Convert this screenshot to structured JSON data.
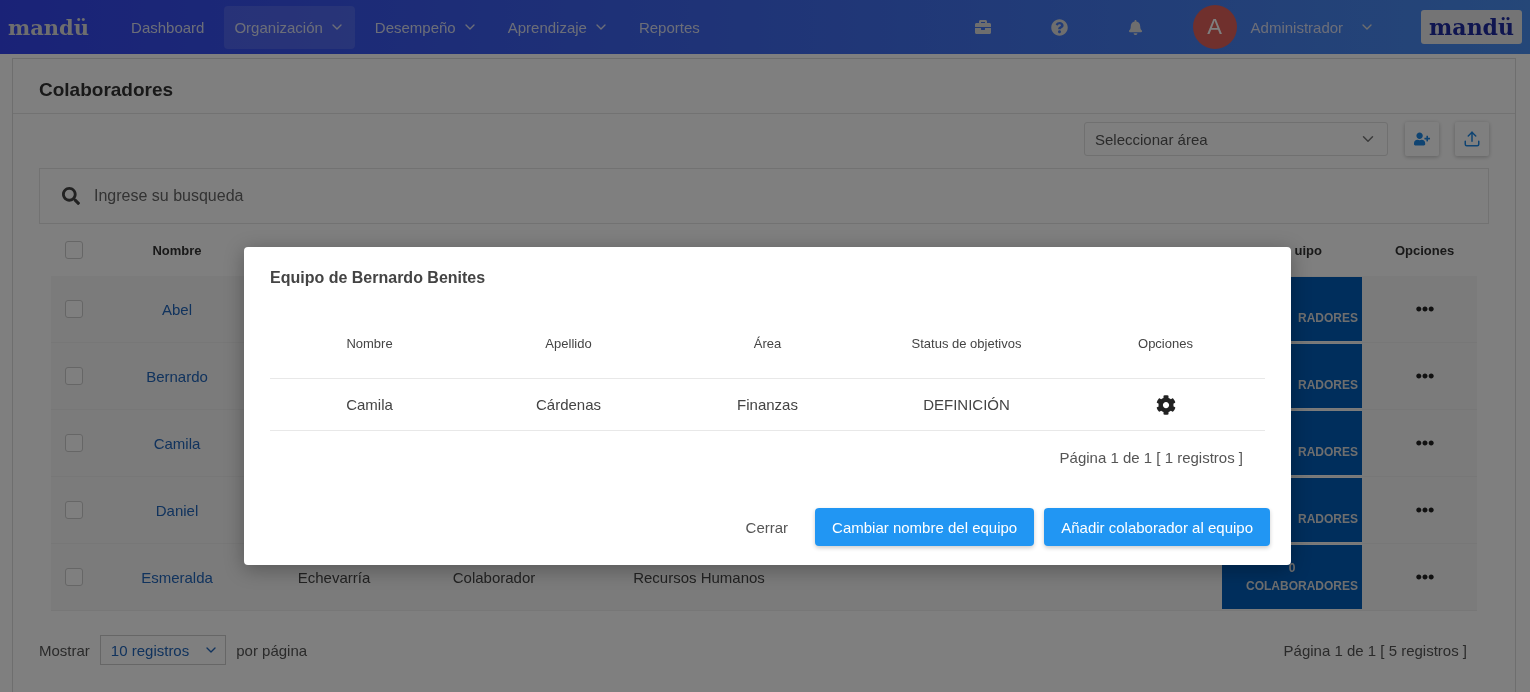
{
  "nav": {
    "logo": "mandü",
    "items": [
      {
        "label": "Dashboard",
        "dropdown": false,
        "selected": false
      },
      {
        "label": "Organización",
        "dropdown": true,
        "selected": true
      },
      {
        "label": "Desempeño",
        "dropdown": true,
        "selected": false
      },
      {
        "label": "Aprendizaje",
        "dropdown": true,
        "selected": false
      },
      {
        "label": "Reportes",
        "dropdown": false,
        "selected": false
      }
    ],
    "user": {
      "initial": "A",
      "name": "Administrador"
    },
    "brand_logo": "mandü"
  },
  "page": {
    "title": "Colaboradores",
    "area_select": {
      "placeholder": "Seleccionar área"
    },
    "search": {
      "placeholder": "Ingrese su busqueda"
    },
    "table": {
      "select_all": {
        "checked": false
      },
      "columns": [
        {
          "label": "Nombre"
        },
        {
          "label": "uipo"
        },
        {
          "label": "Opciones"
        }
      ],
      "rows": [
        {
          "checked": false,
          "name": "Abel",
          "team_label": "RADORES"
        },
        {
          "checked": false,
          "name": "Bernardo",
          "team_label": "RADORES"
        },
        {
          "checked": false,
          "name": "Camila",
          "team_label": "RADORES"
        },
        {
          "checked": false,
          "name": "Daniel",
          "team_label": "RADORES"
        },
        {
          "checked": false,
          "name": "Esmeralda",
          "last_name": "Echevarría",
          "role": "Colaborador",
          "area": "Recursos Humanos",
          "team_count": "0",
          "team_label": "COLABORADORES"
        }
      ]
    },
    "footer": {
      "show_label": "Mostrar",
      "per_page": "10 registros",
      "per_page_suffix": "por página",
      "pagination": "Página 1 de 1 [ 5 registros ]"
    }
  },
  "modal": {
    "title": "Equipo de Bernardo Benites",
    "columns": [
      "Nombre",
      "Apellido",
      "Área",
      "Status de objetivos",
      "Opciones"
    ],
    "rows": [
      {
        "name": "Camila",
        "last_name": "Cárdenas",
        "area": "Finanzas",
        "status": "DEFINICIÓN"
      }
    ],
    "pagination": "Página 1 de 1 [ 1 registros ]",
    "buttons": [
      {
        "label": "Cerrar",
        "kind": "text"
      },
      {
        "label": "Cambiar nombre del equipo",
        "kind": "primary"
      },
      {
        "label": "Añadir colaborador al equipo",
        "kind": "primary"
      }
    ]
  }
}
